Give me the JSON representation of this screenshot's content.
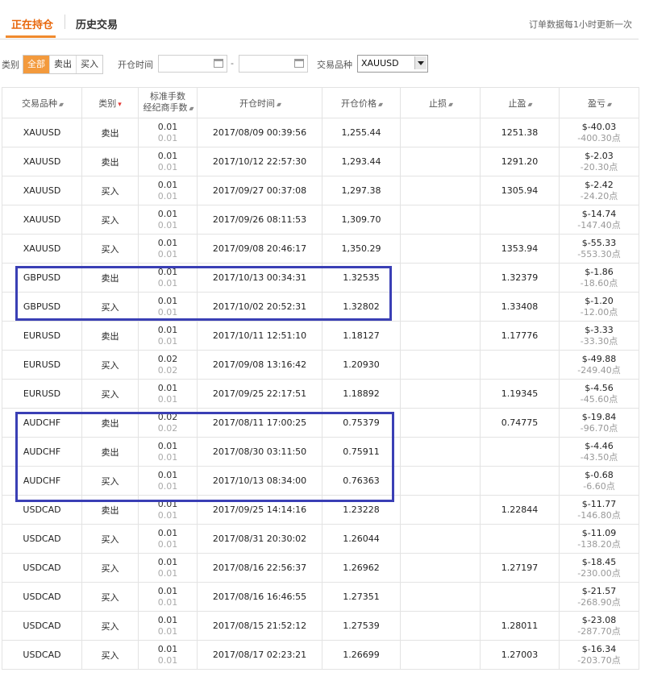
{
  "tabs": [
    {
      "label": "正在持仓",
      "active": true
    },
    {
      "label": "历史交易",
      "active": false
    }
  ],
  "update_note": "订单数据每1小时更新一次",
  "filter": {
    "category_label": "类别",
    "category_options": [
      "全部",
      "卖出",
      "买入"
    ],
    "category_selected": "全部",
    "open_time_label": "开仓时间",
    "date_separator": "-",
    "symbol_label": "交易品种",
    "symbol_value": "XAUUSD"
  },
  "table": {
    "headers": {
      "symbol": "交易品种",
      "type": "类别",
      "fee_line1": "标准手数",
      "fee_line2": "经纪商手数",
      "open_time": "开仓时间",
      "open_price": "开仓价格",
      "stop_loss": "止损",
      "take_profit": "止盈",
      "profit": "盈亏"
    },
    "rows": [
      {
        "symbol": "XAUUSD",
        "type": "卖出",
        "lot1": "0.01",
        "lot2": "0.01",
        "time": "2017/08/09 00:39:56",
        "price": "1,255.44",
        "sl": "",
        "tp": "1251.38",
        "pl": "$-40.03",
        "pts": "-400.30点"
      },
      {
        "symbol": "XAUUSD",
        "type": "卖出",
        "lot1": "0.01",
        "lot2": "0.01",
        "time": "2017/10/12 22:57:30",
        "price": "1,293.44",
        "sl": "",
        "tp": "1291.20",
        "pl": "$-2.03",
        "pts": "-20.30点"
      },
      {
        "symbol": "XAUUSD",
        "type": "买入",
        "lot1": "0.01",
        "lot2": "0.01",
        "time": "2017/09/27 00:37:08",
        "price": "1,297.38",
        "sl": "",
        "tp": "1305.94",
        "pl": "$-2.42",
        "pts": "-24.20点"
      },
      {
        "symbol": "XAUUSD",
        "type": "买入",
        "lot1": "0.01",
        "lot2": "0.01",
        "time": "2017/09/26 08:11:53",
        "price": "1,309.70",
        "sl": "",
        "tp": "",
        "pl": "$-14.74",
        "pts": "-147.40点"
      },
      {
        "symbol": "XAUUSD",
        "type": "买入",
        "lot1": "0.01",
        "lot2": "0.01",
        "time": "2017/09/08 20:46:17",
        "price": "1,350.29",
        "sl": "",
        "tp": "1353.94",
        "pl": "$-55.33",
        "pts": "-553.30点"
      },
      {
        "symbol": "GBPUSD",
        "type": "卖出",
        "lot1": "0.01",
        "lot2": "0.01",
        "time": "2017/10/13 00:34:31",
        "price": "1.32535",
        "sl": "",
        "tp": "1.32379",
        "pl": "$-1.86",
        "pts": "-18.60点"
      },
      {
        "symbol": "GBPUSD",
        "type": "买入",
        "lot1": "0.01",
        "lot2": "0.01",
        "time": "2017/10/02 20:52:31",
        "price": "1.32802",
        "sl": "",
        "tp": "1.33408",
        "pl": "$-1.20",
        "pts": "-12.00点"
      },
      {
        "symbol": "EURUSD",
        "type": "卖出",
        "lot1": "0.01",
        "lot2": "0.01",
        "time": "2017/10/11 12:51:10",
        "price": "1.18127",
        "sl": "",
        "tp": "1.17776",
        "pl": "$-3.33",
        "pts": "-33.30点"
      },
      {
        "symbol": "EURUSD",
        "type": "买入",
        "lot1": "0.02",
        "lot2": "0.02",
        "time": "2017/09/08 13:16:42",
        "price": "1.20930",
        "sl": "",
        "tp": "",
        "pl": "$-49.88",
        "pts": "-249.40点"
      },
      {
        "symbol": "EURUSD",
        "type": "买入",
        "lot1": "0.01",
        "lot2": "0.01",
        "time": "2017/09/25 22:17:51",
        "price": "1.18892",
        "sl": "",
        "tp": "1.19345",
        "pl": "$-4.56",
        "pts": "-45.60点"
      },
      {
        "symbol": "AUDCHF",
        "type": "卖出",
        "lot1": "0.02",
        "lot2": "0.02",
        "time": "2017/08/11 17:00:25",
        "price": "0.75379",
        "sl": "",
        "tp": "0.74775",
        "pl": "$-19.84",
        "pts": "-96.70点"
      },
      {
        "symbol": "AUDCHF",
        "type": "卖出",
        "lot1": "0.01",
        "lot2": "0.01",
        "time": "2017/08/30 03:11:50",
        "price": "0.75911",
        "sl": "",
        "tp": "",
        "pl": "$-4.46",
        "pts": "-43.50点"
      },
      {
        "symbol": "AUDCHF",
        "type": "买入",
        "lot1": "0.01",
        "lot2": "0.01",
        "time": "2017/10/13 08:34:00",
        "price": "0.76363",
        "sl": "",
        "tp": "",
        "pl": "$-0.68",
        "pts": "-6.60点"
      },
      {
        "symbol": "USDCAD",
        "type": "卖出",
        "lot1": "0.01",
        "lot2": "0.01",
        "time": "2017/09/25 14:14:16",
        "price": "1.23228",
        "sl": "",
        "tp": "1.22844",
        "pl": "$-11.77",
        "pts": "-146.80点"
      },
      {
        "symbol": "USDCAD",
        "type": "买入",
        "lot1": "0.01",
        "lot2": "0.01",
        "time": "2017/08/31 20:30:02",
        "price": "1.26044",
        "sl": "",
        "tp": "",
        "pl": "$-11.09",
        "pts": "-138.20点"
      },
      {
        "symbol": "USDCAD",
        "type": "买入",
        "lot1": "0.01",
        "lot2": "0.01",
        "time": "2017/08/16 22:56:37",
        "price": "1.26962",
        "sl": "",
        "tp": "1.27197",
        "pl": "$-18.45",
        "pts": "-230.00点"
      },
      {
        "symbol": "USDCAD",
        "type": "买入",
        "lot1": "0.01",
        "lot2": "0.01",
        "time": "2017/08/16 16:46:55",
        "price": "1.27351",
        "sl": "",
        "tp": "",
        "pl": "$-21.57",
        "pts": "-268.90点"
      },
      {
        "symbol": "USDCAD",
        "type": "买入",
        "lot1": "0.01",
        "lot2": "0.01",
        "time": "2017/08/15 21:52:12",
        "price": "1.27539",
        "sl": "",
        "tp": "1.28011",
        "pl": "$-23.08",
        "pts": "-287.70点"
      },
      {
        "symbol": "USDCAD",
        "type": "买入",
        "lot1": "0.01",
        "lot2": "0.01",
        "time": "2017/08/17 02:23:21",
        "price": "1.26699",
        "sl": "",
        "tp": "1.27003",
        "pl": "$-16.34",
        "pts": "-203.70点"
      }
    ]
  },
  "colors": {
    "accent": "#e8670c",
    "sell": "#e53935",
    "buy": "#1f9d3a",
    "highlight_box": "#3a3fb5"
  }
}
